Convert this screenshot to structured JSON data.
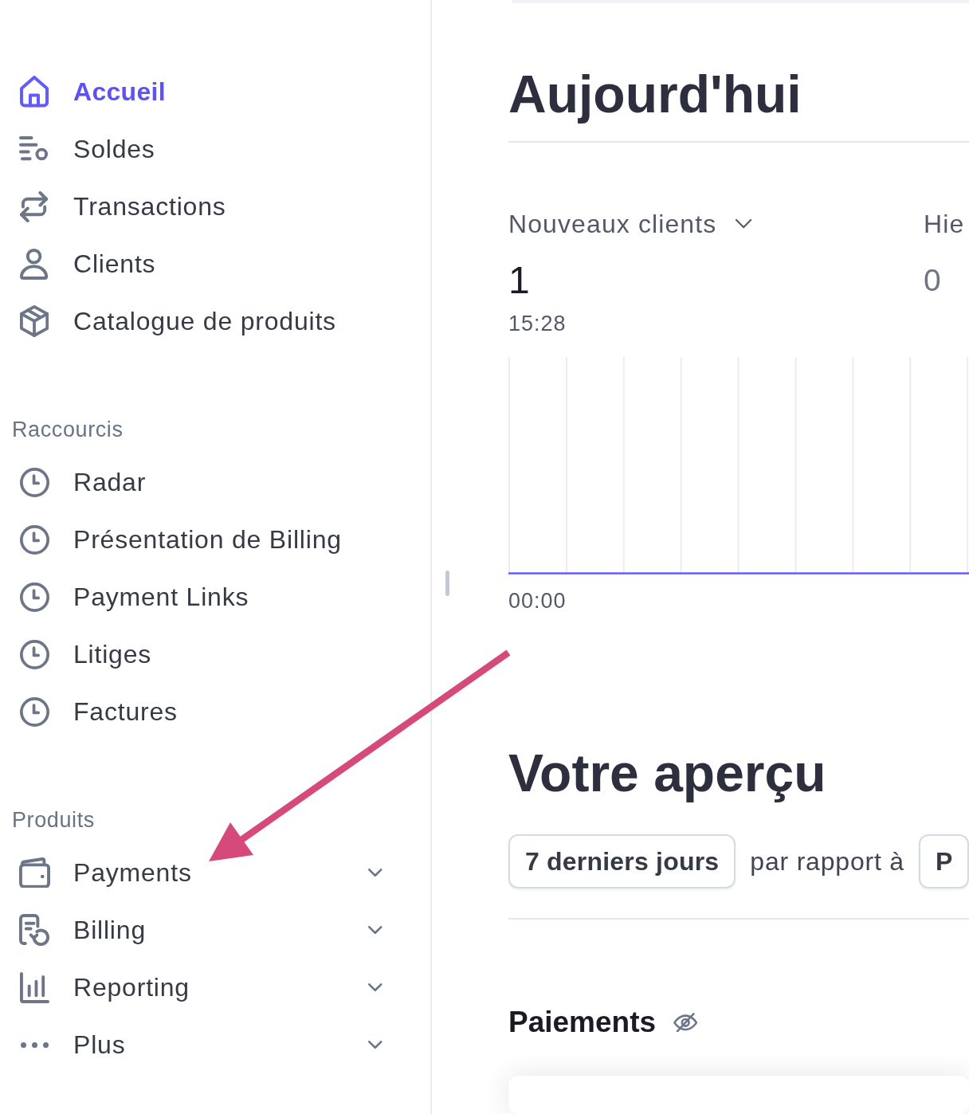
{
  "sidebar": {
    "nav": [
      {
        "label": "Accueil",
        "selected": true
      },
      {
        "label": "Soldes",
        "selected": false
      },
      {
        "label": "Transactions",
        "selected": false
      },
      {
        "label": "Clients",
        "selected": false
      },
      {
        "label": "Catalogue de produits",
        "selected": false
      }
    ],
    "sections": [
      {
        "title": "Raccourcis",
        "items": [
          {
            "label": "Radar",
            "selected": false
          },
          {
            "label": "Présentation de Billing",
            "selected": false
          },
          {
            "label": "Payment Links",
            "selected": false
          },
          {
            "label": "Litiges",
            "selected": false
          },
          {
            "label": "Factures",
            "selected": false
          }
        ]
      },
      {
        "title": "Produits",
        "items": [
          {
            "label": "Payments",
            "selected": false,
            "expanded": false
          },
          {
            "label": "Billing",
            "selected": false,
            "expanded": false
          },
          {
            "label": "Reporting",
            "selected": false,
            "expanded": false
          },
          {
            "label": "Plus",
            "selected": false,
            "expanded": false
          }
        ]
      }
    ]
  },
  "today": {
    "title": "Aujourd'hui",
    "metrics": [
      {
        "kind": "primary",
        "title": "Nouveaux clients",
        "value": "1",
        "time": "15:28"
      },
      {
        "kind": "comparison",
        "title": "Hie",
        "value": "0"
      }
    ],
    "chart": {
      "tick_label": "00:00"
    }
  },
  "overview": {
    "title": "Votre aperçu",
    "filters": [
      {
        "kind": "button",
        "label": "7 derniers jours"
      },
      {
        "kind": "text",
        "label": "par rapport à"
      },
      {
        "kind": "button",
        "label": "P"
      }
    ],
    "sections": [
      {
        "title": "Paiements",
        "hidden": true
      }
    ]
  },
  "annotation": {
    "kind": "arrow"
  }
}
